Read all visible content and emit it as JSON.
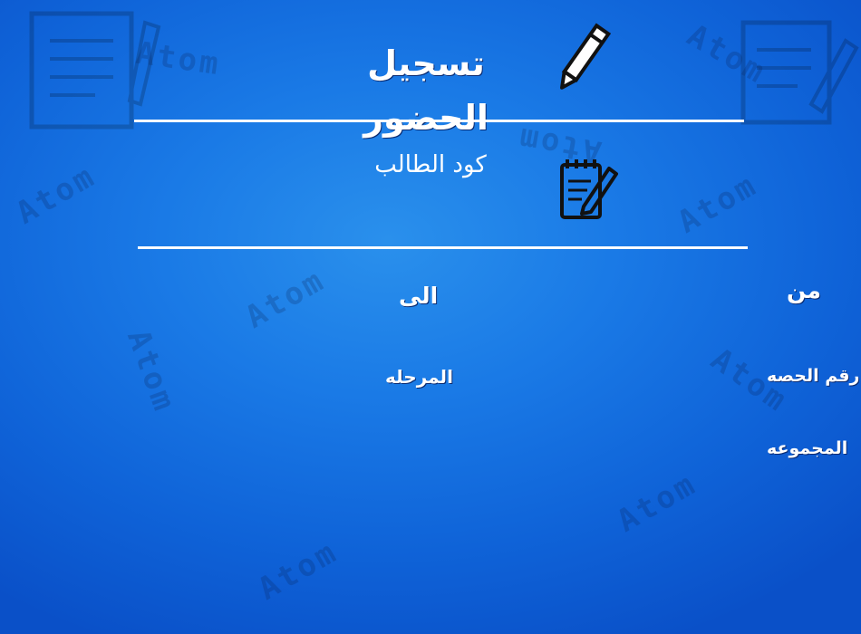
{
  "header": {
    "title": "تسجيل الحضور",
    "icon": "pencil-icon"
  },
  "student_code": {
    "label": "كود الطالب",
    "icon": "notepad-pencil-icon"
  },
  "fields": {
    "from_label": "من",
    "to_label": "الى",
    "session_number_label": "رقم الحصه",
    "stage_label": "المرحله",
    "group_label": "المجموعه"
  },
  "watermark": {
    "text": "Atom"
  },
  "colors": {
    "background": "#1672e0",
    "text": "#ffffff",
    "icon_stroke": "#111111"
  }
}
